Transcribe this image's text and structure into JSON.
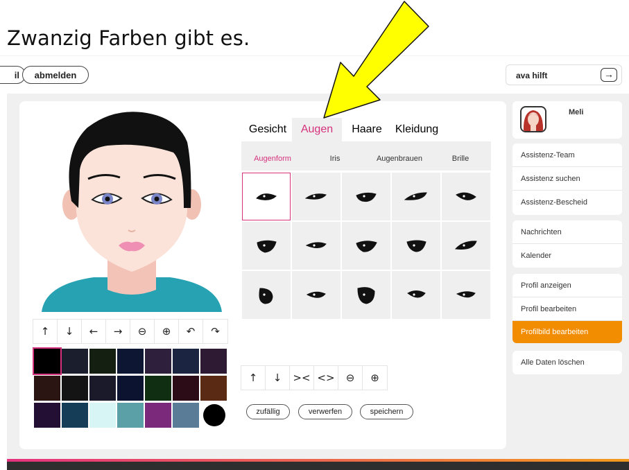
{
  "caption": "Zwanzig Farben gibt es.",
  "header": {
    "left_pill_partial": "il",
    "logout_label": "abmelden",
    "help_label": "ava hilft",
    "help_arrow": "→"
  },
  "avatar_toolbar": {
    "buttons": [
      {
        "icon": "arrow-up-icon",
        "glyph": "↑"
      },
      {
        "icon": "arrow-down-icon",
        "glyph": "↓"
      },
      {
        "icon": "arrow-left-icon",
        "glyph": "←"
      },
      {
        "icon": "arrow-right-icon",
        "glyph": "→"
      },
      {
        "icon": "zoom-out-icon",
        "glyph": "🔍"
      },
      {
        "icon": "zoom-in-icon",
        "glyph": "🔍"
      },
      {
        "icon": "undo-icon",
        "glyph": "↶"
      },
      {
        "icon": "redo-icon",
        "glyph": "↷"
      }
    ]
  },
  "colors": [
    "#000000",
    "#1b1e2c",
    "#141f12",
    "#0d1733",
    "#2e1f3d",
    "#1b2440",
    "#2f1a33",
    "#2b1512",
    "#141414",
    "#1a1a2a",
    "#0c1330",
    "#0f2e12",
    "#2c0c17",
    "#5a2a14",
    "#220f33",
    "#163d57",
    "#d8f5f5",
    "#5aa0a6",
    "#7b2a7b",
    "#5b7c96",
    "#000000"
  ],
  "selected_color_index": 0,
  "tabs": [
    "Gesicht",
    "Augen",
    "Haare",
    "Kleidung"
  ],
  "active_tab_index": 1,
  "subtabs": [
    "Augenform",
    "Iris",
    "Augenbrauen",
    "Brille"
  ],
  "active_subtab_index": 0,
  "eye_shapes_count": 15,
  "selected_eye_index": 0,
  "eye_toolbar": {
    "buttons": [
      {
        "icon": "arrow-up-icon",
        "glyph": "↑"
      },
      {
        "icon": "arrow-down-icon",
        "glyph": "↓"
      },
      {
        "icon": "narrow-icon",
        "glyph": "><"
      },
      {
        "icon": "widen-icon",
        "glyph": "<>"
      },
      {
        "icon": "zoom-out-icon",
        "glyph": "🔍"
      },
      {
        "icon": "zoom-in-icon",
        "glyph": "🔍"
      }
    ]
  },
  "actions": {
    "random": "zufällig",
    "discard": "verwerfen",
    "save": "speichern"
  },
  "sidebar": {
    "user_name": "Meli",
    "group1": [
      "Assistenz-Team",
      "Assistenz suchen",
      "Assistenz-Bescheid"
    ],
    "group2": [
      "Nachrichten",
      "Kalender"
    ],
    "group3": [
      "Profil anzeigen",
      "Profil bearbeiten",
      "Profilbild bearbeiten"
    ],
    "group4": [
      "Alle Daten löschen"
    ],
    "active_item": "Profilbild bearbeiten"
  },
  "theme": {
    "accent_pink": "#d6317c",
    "accent_orange": "#f28c00",
    "annotation_arrow": "#ffff00"
  }
}
